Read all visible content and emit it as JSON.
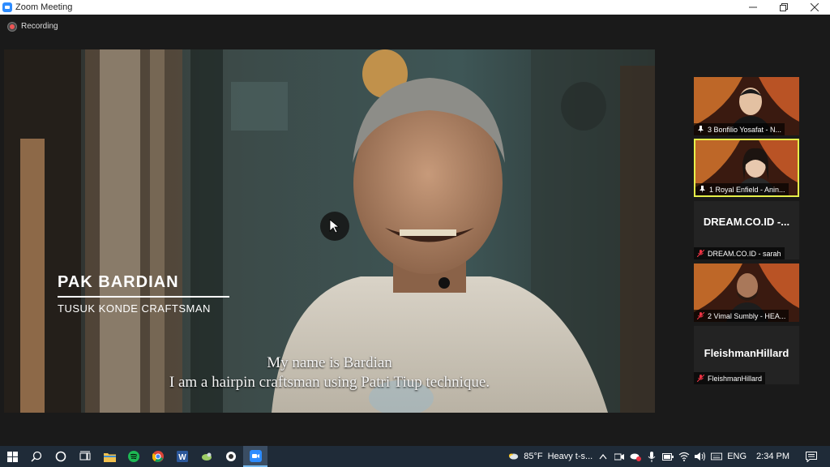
{
  "window": {
    "title": "Zoom Meeting"
  },
  "meeting": {
    "recording_label": "Recording"
  },
  "video": {
    "lower_third_name": "PAK BARDIAN",
    "lower_third_role": "TUSUK KONDE CRAFTSMAN",
    "subtitle_line1": "My name is Bardian",
    "subtitle_line2": "I am a hairpin craftsman using Patri Tiup technique."
  },
  "participants": [
    {
      "name": "3  Bonfilio Yosafat - N...",
      "type": "video",
      "pinned": true,
      "active": false
    },
    {
      "name": "1  Royal Enfield - Anin...",
      "type": "video",
      "pinned": true,
      "active": true
    },
    {
      "label": "DREAM.CO.ID  -...",
      "name": "DREAM.CO.ID - sarah",
      "type": "name",
      "muted": true
    },
    {
      "name": "2  Vimal Sumbly - HEA...",
      "type": "video",
      "muted": true
    },
    {
      "label": "FleishmanHillard",
      "name": "FleishmanHillard",
      "type": "name",
      "muted": true
    }
  ],
  "taskbar": {
    "weather_temp": "85°F",
    "weather_text": "Heavy t-s...",
    "language": "ENG",
    "time": "2:34 PM"
  },
  "colors": {
    "zoom_blue": "#2d8cff",
    "active_speaker": "#e6f04a",
    "taskbar": "#1f2b38"
  }
}
